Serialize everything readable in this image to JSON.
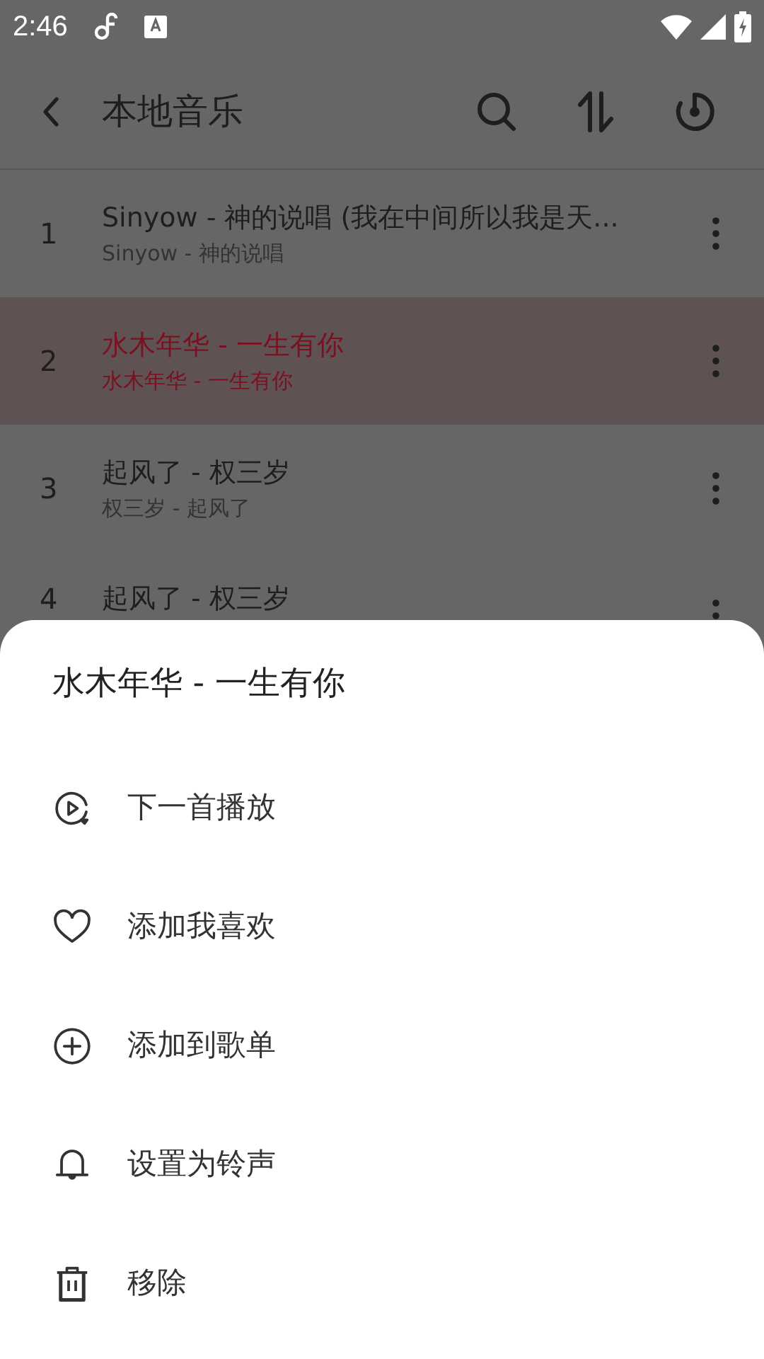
{
  "status_bar": {
    "time": "2:46"
  },
  "toolbar": {
    "title": "本地音乐"
  },
  "songs": [
    {
      "number": "1",
      "title": "Sinyow - 神的说唱 (我在中间所以我是天...",
      "subtitle": "Sinyow - 神的说唱",
      "selected": false
    },
    {
      "number": "2",
      "title": "水木年华 - 一生有你",
      "subtitle": "水木年华 - 一生有你",
      "selected": true
    },
    {
      "number": "3",
      "title": "起风了 - 权三岁",
      "subtitle": "权三岁 - 起风了",
      "selected": false
    },
    {
      "number": "4",
      "title": "起风了 - 权三岁",
      "selected": false
    }
  ],
  "sheet": {
    "title": "水木年华 - 一生有你",
    "items": [
      {
        "kind": "play-next",
        "label": "下一首播放"
      },
      {
        "kind": "favorite",
        "label": "添加我喜欢"
      },
      {
        "kind": "add-to-playlist",
        "label": "添加到歌单"
      },
      {
        "kind": "ringtone",
        "label": "设置为铃声"
      },
      {
        "kind": "remove",
        "label": "移除"
      }
    ]
  }
}
